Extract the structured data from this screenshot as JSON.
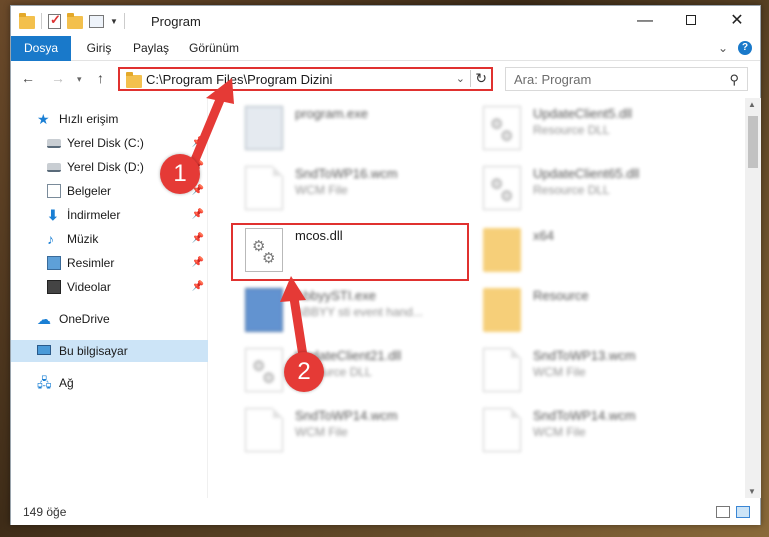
{
  "window": {
    "title": "Program"
  },
  "titlebar": {
    "minimize_glyph": "—",
    "close_glyph": "✕"
  },
  "ribbon": {
    "tabs": [
      "Dosya",
      "Giriş",
      "Paylaş",
      "Görünüm"
    ]
  },
  "nav": {
    "back_glyph": "←",
    "forward_glyph": "→",
    "recent_glyph": "▾",
    "up_glyph": "↑"
  },
  "address": {
    "path": "C:\\Program Files\\Program Dizini"
  },
  "search": {
    "placeholder": "Ara: Program"
  },
  "sidebar": {
    "items": [
      {
        "label": "Hızlı erişim",
        "icon": "star-icon"
      },
      {
        "label": "Yerel Disk (C:)",
        "icon": "disk-icon",
        "pinned": true
      },
      {
        "label": "Yerel Disk (D:)",
        "icon": "disk-icon",
        "pinned": true
      },
      {
        "label": "Belgeler",
        "icon": "document-icon",
        "pinned": true
      },
      {
        "label": "İndirmeler",
        "icon": "download-icon",
        "pinned": true
      },
      {
        "label": "Müzik",
        "icon": "music-icon",
        "pinned": true
      },
      {
        "label": "Resimler",
        "icon": "pictures-icon",
        "pinned": true
      },
      {
        "label": "Videolar",
        "icon": "video-icon",
        "pinned": true
      },
      {
        "label": "OneDrive",
        "icon": "cloud-icon"
      },
      {
        "label": "Bu bilgisayar",
        "icon": "computer-icon",
        "selected": true
      },
      {
        "label": "Ağ",
        "icon": "network-icon"
      }
    ]
  },
  "files": [
    {
      "name": "program.exe",
      "desc": "",
      "type": "exe"
    },
    {
      "name": "UpdateClient5.dll",
      "desc": "Resource DLL",
      "type": "dll"
    },
    {
      "name": "SndToWP16.wcm",
      "desc": "WCM File",
      "type": "file"
    },
    {
      "name": "UpdateClient65.dll",
      "desc": "Resource DLL",
      "type": "dll"
    },
    {
      "name": "mcos.dll",
      "desc": "",
      "type": "dll",
      "highlighted": true
    },
    {
      "name": "x64",
      "desc": "",
      "type": "folder"
    },
    {
      "name": "AbbyySTI.exe",
      "desc": "ABBYY sti event hand...",
      "type": "exe"
    },
    {
      "name": "Resource",
      "desc": "",
      "type": "folder"
    },
    {
      "name": "UpdateClient21.dll",
      "desc": "Resource DLL",
      "type": "dll"
    },
    {
      "name": "SndToWP13.wcm",
      "desc": "WCM File",
      "type": "file"
    },
    {
      "name": "SndToWP14.wcm",
      "desc": "WCM File",
      "type": "file"
    },
    {
      "name": "SndToWP14.wcm",
      "desc": "WCM File",
      "type": "file"
    }
  ],
  "status": {
    "item_count": "149 öğe"
  },
  "annotations": {
    "step1": "1",
    "step2": "2"
  },
  "colors": {
    "accent": "#1979ca",
    "highlight": "#e0312f",
    "badge": "#e53a36",
    "selected": "#cce4f7"
  }
}
